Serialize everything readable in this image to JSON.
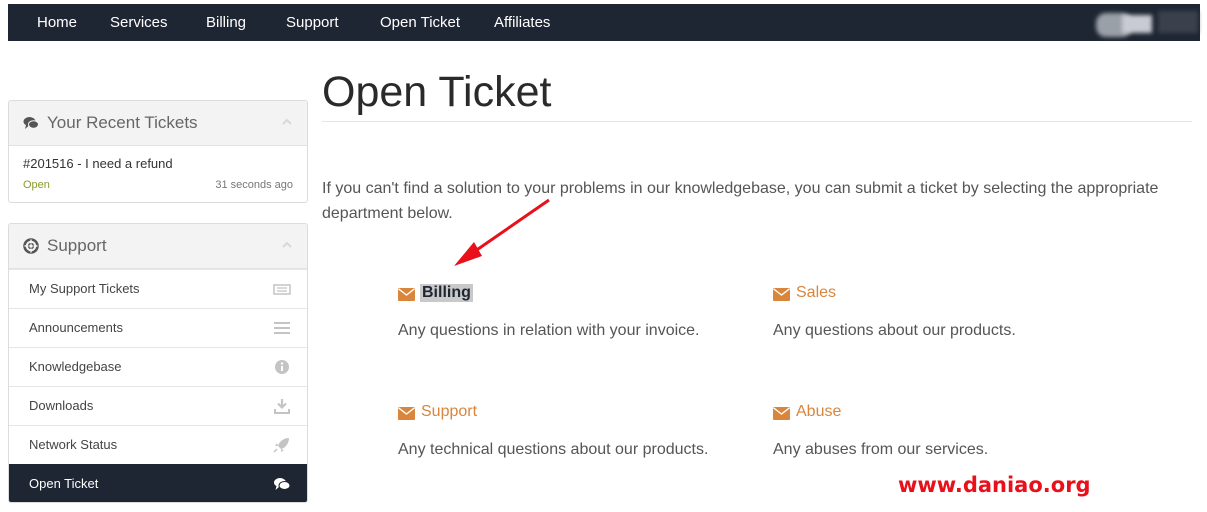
{
  "nav": {
    "items": [
      "Home",
      "Services",
      "Billing",
      "Support",
      "Open Ticket",
      "Affiliates"
    ]
  },
  "recent_tickets": {
    "title": "Your Recent Tickets",
    "ticket": {
      "title": "#201516 - I need a refund",
      "status": "Open",
      "time": "31 seconds ago"
    }
  },
  "support_panel": {
    "title": "Support",
    "items": [
      {
        "label": "My Support Tickets",
        "icon": "ticket-icon"
      },
      {
        "label": "Announcements",
        "icon": "list-icon"
      },
      {
        "label": "Knowledgebase",
        "icon": "info-icon"
      },
      {
        "label": "Downloads",
        "icon": "download-icon"
      },
      {
        "label": "Network Status",
        "icon": "rocket-icon"
      },
      {
        "label": "Open Ticket",
        "icon": "comments-icon",
        "active": true
      }
    ]
  },
  "main": {
    "title": "Open Ticket",
    "intro": "If you can't find a solution to your problems in our knowledgebase, you can submit a ticket by selecting the appropriate department below.",
    "departments": [
      {
        "name": "Billing",
        "description": "Any questions in relation with your invoice.",
        "highlighted": true
      },
      {
        "name": "Sales",
        "description": "Any questions about our products."
      },
      {
        "name": "Support",
        "description": "Any technical questions about our products."
      },
      {
        "name": "Abuse",
        "description": "Any abuses from our services."
      }
    ]
  },
  "watermark": "www.daniao.org",
  "colors": {
    "nav_bg": "#1f2633",
    "accent": "#d9853b",
    "status_open": "#8a9a2e",
    "annotation_arrow": "#e8101a"
  }
}
